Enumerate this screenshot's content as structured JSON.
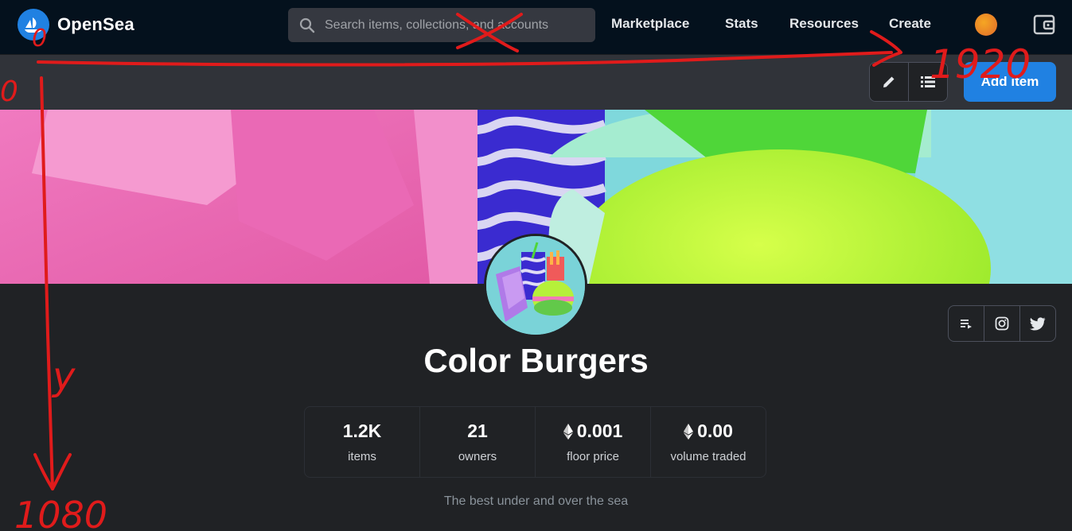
{
  "nav": {
    "brand": "OpenSea",
    "search_placeholder": "Search items, collections, and accounts",
    "links": [
      "Marketplace",
      "Stats",
      "Resources",
      "Create"
    ]
  },
  "toolbar": {
    "add_item_label": "Add item"
  },
  "collection": {
    "name": "Color Burgers",
    "description": "The best under and over the sea",
    "stats": [
      {
        "value": "1.2K",
        "label": "items",
        "eth": false
      },
      {
        "value": "21",
        "label": "owners",
        "eth": false
      },
      {
        "value": "0.001",
        "label": "floor price",
        "eth": true
      },
      {
        "value": "0.00",
        "label": "volume traded",
        "eth": true
      }
    ]
  },
  "annotations": {
    "origin_x": "0",
    "origin_y": "0",
    "width": "1920",
    "height": "1080",
    "y_label": "y"
  },
  "colors": {
    "nav_bg": "#04111d",
    "accent": "#2081e2",
    "page_bg": "#202225",
    "annotation": "#e01b1b"
  }
}
